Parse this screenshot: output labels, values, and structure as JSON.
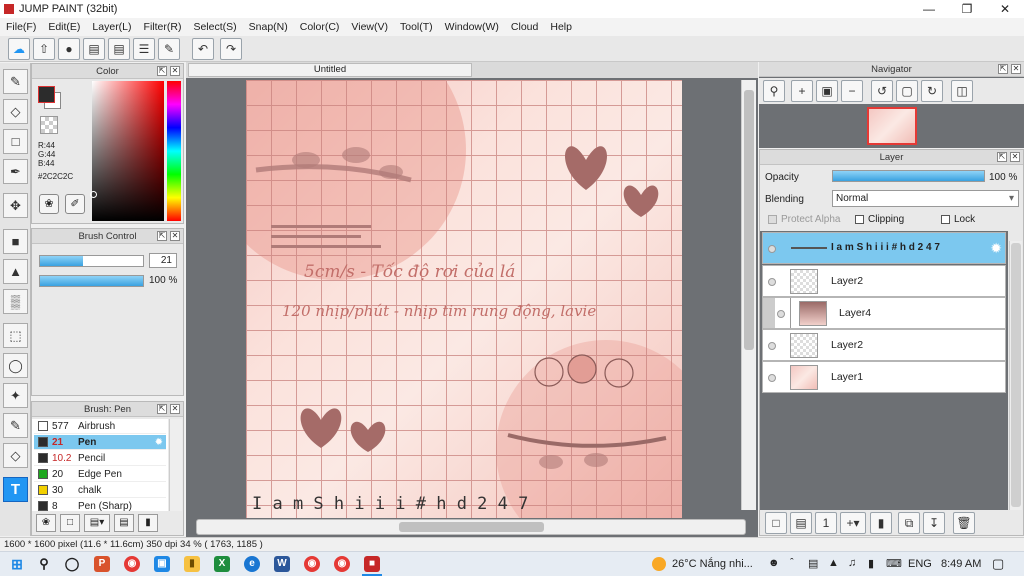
{
  "window": {
    "title": "JUMP PAINT (32bit)"
  },
  "menu": [
    "File(F)",
    "Edit(E)",
    "Layer(L)",
    "Filter(R)",
    "Select(S)",
    "Snap(N)",
    "Color(C)",
    "View(V)",
    "Tool(T)",
    "Window(W)",
    "Cloud",
    "Help"
  ],
  "document": {
    "tab_title": "Untitled"
  },
  "color_panel": {
    "title": "Color",
    "r": "R:44",
    "g": "G:44",
    "b": "B:44",
    "hex": "#2C2C2C"
  },
  "brush_control": {
    "title": "Brush Control",
    "size": "21",
    "size_fraction": 0.42,
    "opacity": "100 %",
    "opacity_fraction": 1.0
  },
  "brush_panel": {
    "title": "Brush: Pen",
    "items": [
      {
        "size": "577",
        "name": "Airbrush",
        "color": "#ffffff"
      },
      {
        "size": "21",
        "name": "Pen",
        "color": "#2c2c2c"
      },
      {
        "size": "10.2",
        "name": "Pencil",
        "color": "#2c2c2c"
      },
      {
        "size": "20",
        "name": "Edge Pen",
        "color": "#1fa81f"
      },
      {
        "size": "30",
        "name": "chalk",
        "color": "#f2d000"
      },
      {
        "size": "8",
        "name": "Pen (Sharp)",
        "color": "#2c2c2c"
      }
    ]
  },
  "canvas_text": {
    "line1": "5cm/s - Tốc độ rơi của lá",
    "line2": "120 nhịp/phút - nhịp tim rung động, lavie",
    "signature": "I a m S h i i i # h d 2 4 7"
  },
  "navigator": {
    "title": "Navigator"
  },
  "layer_panel": {
    "title": "Layer",
    "opacity_label": "Opacity",
    "opacity_value": "100 %",
    "opacity_fraction": 1.0,
    "blending_label": "Blending",
    "blending_value": "Normal",
    "protect_alpha": "Protect Alpha",
    "clipping": "Clipping",
    "lock": "Lock",
    "layers": [
      {
        "name": "I a m S h i i i # h d 2 4 7"
      },
      {
        "name": "Layer2"
      },
      {
        "name": "Layer4"
      },
      {
        "name": "Layer2"
      },
      {
        "name": "Layer1"
      }
    ]
  },
  "status": {
    "text": "1600 * 1600 pixel   (11.6 * 11.6cm)   350 dpi   34 %   ( 1763, 1185 )"
  },
  "taskbar": {
    "weather": "26°C  Nắng nhi...",
    "lang": "ENG",
    "time": "8:49 AM"
  },
  "colors": {
    "accent": "#2196f3",
    "selected_row": "#7cc8ef",
    "fg_color": "#2c2c2c"
  }
}
